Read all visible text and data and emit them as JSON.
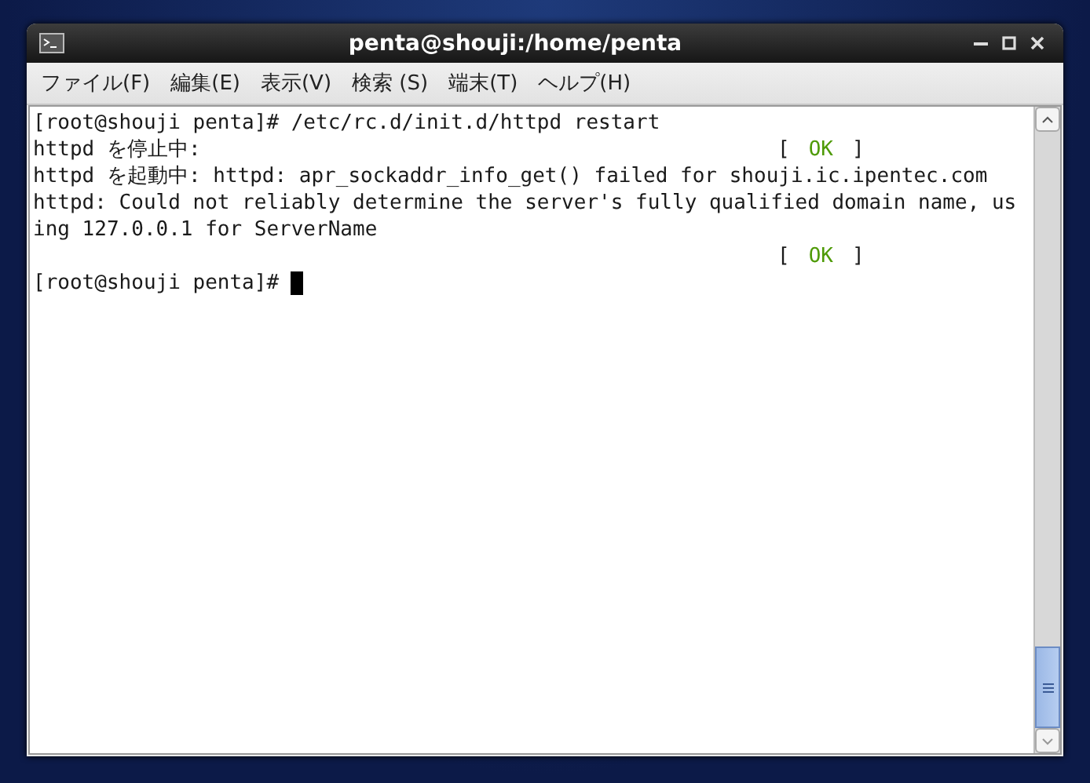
{
  "window": {
    "title": "penta@shouji:/home/penta"
  },
  "menu": [
    "ファイル(F)",
    "編集(E)",
    "表示(V)",
    "検索 (S)",
    "端末(T)",
    "ヘルプ(H)"
  ],
  "terminal": {
    "lines": [
      {
        "text": "[root@shouji penta]# /etc/rc.d/init.d/httpd restart"
      },
      {
        "text": "httpd を停止中:",
        "status": {
          "open": "[",
          "label": "OK",
          "close": "]"
        }
      },
      {
        "text": "httpd を起動中: httpd: apr_sockaddr_info_get() failed for shouji.ic.ipentec.com"
      },
      {
        "text": "httpd: Could not reliably determine the server's fully qualified domain name, us"
      },
      {
        "text": "ing 127.0.0.1 for ServerName"
      },
      {
        "status": {
          "open": "[",
          "label": "OK",
          "close": "]"
        }
      },
      {
        "text": "[root@shouji penta]# ",
        "cursor": true
      }
    ]
  }
}
